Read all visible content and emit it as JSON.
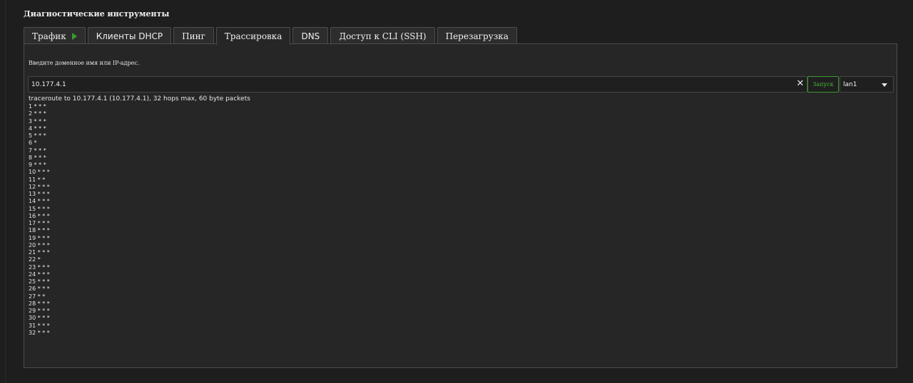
{
  "section": {
    "title": "Диагностические инструменты"
  },
  "tabs": [
    {
      "label": "Трафик",
      "font": "serif",
      "active": false,
      "icon": "play-icon"
    },
    {
      "label": "Клиенты DHCP",
      "font": "sans",
      "active": false
    },
    {
      "label": "Пинг",
      "font": "serif",
      "active": false
    },
    {
      "label": "Трассировка",
      "font": "serif",
      "active": true
    },
    {
      "label": "DNS",
      "font": "sans",
      "active": false
    },
    {
      "label": "Доступ к CLI (SSH)",
      "font": "mixed",
      "active": false
    },
    {
      "label": "Перезагрузка",
      "font": "serif",
      "active": false
    }
  ],
  "form": {
    "prompt": "Введите доменное имя или IP-адрес.",
    "host_value": "10.177.4.1",
    "clear_icon": "close-icon",
    "start_label": "Запуск",
    "interface_value": "lan1",
    "interface_icon": "chevron-down-icon"
  },
  "output": {
    "header": "traceroute to 10.177.4.1 (10.177.4.1), 32 hops max, 60 byte packets",
    "hops": [
      "1 * * *",
      "2 * * *",
      "3 * * *",
      "4 * * *",
      "5 * * *",
      "6 *",
      "7 * * *",
      "8 * * *",
      "9 * * *",
      "10 * * *",
      "11 * *",
      "12 * * *",
      "13 * * *",
      "14 * * *",
      "15 * * *",
      "16 * * *",
      "17 * * *",
      "18 * * *",
      "19 * * *",
      "20 * * *",
      "21 * * *",
      "22 *",
      "23 * * *",
      "24 * * *",
      "25 * * *",
      "26 * * *",
      "27 * *",
      "28 * * *",
      "29 * * *",
      "30 * * *",
      "31 * * *",
      "32 * * *"
    ]
  },
  "colors": {
    "accent_green": "#3a9b2f",
    "background": "#1e1e1e",
    "panel": "#262626"
  }
}
